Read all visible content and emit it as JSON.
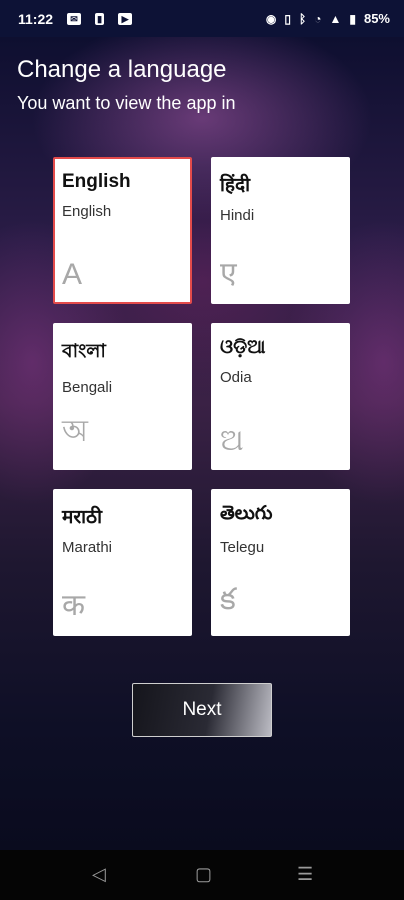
{
  "status_bar": {
    "time": "11:22",
    "battery": "85%",
    "left_icons": [
      "message-icon",
      "sim-icon",
      "youtube-icon"
    ],
    "right_icons": [
      "location-icon",
      "vibrate-icon",
      "bluetooth-icon",
      "wifi-icon",
      "signal-icon",
      "battery-icon"
    ]
  },
  "header": {
    "title": "Change a language",
    "subtitle": "You want to view the app in"
  },
  "languages": [
    {
      "native": "English",
      "english": "English",
      "glyph": "A",
      "selected": true
    },
    {
      "native": "हिंदी",
      "english": "Hindi",
      "glyph": "ए",
      "selected": false
    },
    {
      "native": "বাংলা",
      "english": "Bengali",
      "glyph": "অ",
      "selected": false
    },
    {
      "native": "ଓଡ଼ିଆ",
      "english": "Odia",
      "glyph": "ଅ",
      "selected": false
    },
    {
      "native": "मराठी",
      "english": "Marathi",
      "glyph": "क",
      "selected": false
    },
    {
      "native": "తెలుగు",
      "english": "Telegu",
      "glyph": "క",
      "selected": false
    }
  ],
  "next_button": {
    "label": "Next"
  },
  "colors": {
    "selected_border": "#e34b4b",
    "status_bar_bg": "#0d1236"
  },
  "nav_bar": {
    "buttons": [
      "back-icon",
      "home-icon",
      "recents-icon"
    ]
  }
}
